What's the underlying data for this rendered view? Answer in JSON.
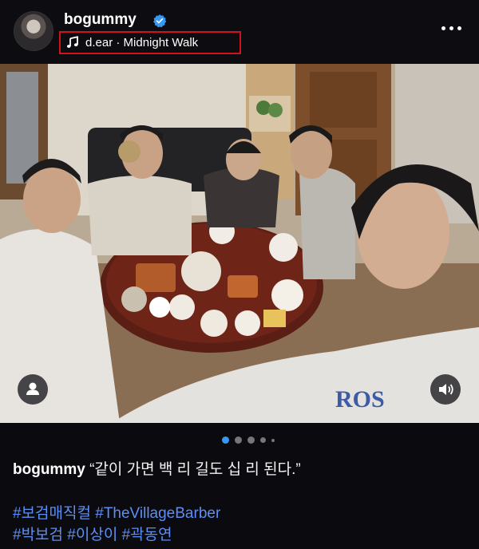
{
  "post": {
    "username": "bogummy",
    "verified": true,
    "music_label": "d.ear · Midnight Walk",
    "caption_user": "bogummy",
    "caption_text": "“같이 가면 백 리 길도 십 리 된다.”",
    "hashtags_line1": [
      "#보검매직컬",
      "#TheVillageBarber"
    ],
    "hashtags_line2": [
      "#박보검",
      "#이상이",
      "#곽동연"
    ],
    "carousel": {
      "total": 5,
      "active": 1
    }
  },
  "icons": {
    "avatar": "profile-avatar",
    "verified": "verified-badge-icon",
    "music": "music-note-icon",
    "more": "more-options-icon",
    "tagged_users": "user-tag-icon",
    "sound": "speaker-icon"
  },
  "colors": {
    "background": "#0b0b0f",
    "hashtag": "#5b8ff6",
    "verified": "#3897f0",
    "highlight_box": "#d0121b",
    "dot_active": "#3897f0",
    "dot_inactive": "#777777"
  }
}
